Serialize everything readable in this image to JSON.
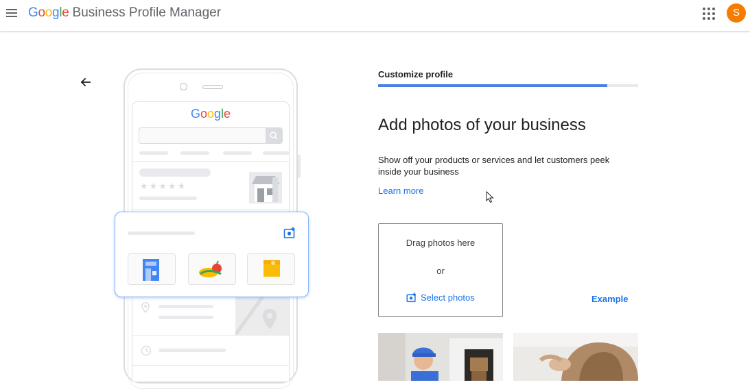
{
  "header": {
    "logo_letters": [
      "G",
      "o",
      "o",
      "g",
      "l",
      "e"
    ],
    "product": "Business Profile Manager",
    "avatar_initial": "S"
  },
  "illustration": {
    "logo_letters": [
      "G",
      "o",
      "o",
      "g",
      "l",
      "e"
    ],
    "stars": "★★★★★"
  },
  "main": {
    "step_label": "Customize profile",
    "progress": 0.88,
    "title": "Add photos of your business",
    "description": "Show off your products or services and let customers peek inside your business",
    "learn_more": "Learn more",
    "drop_text": "Drag photos here",
    "or_text": "or",
    "select_photos": "Select photos",
    "example": "Example"
  },
  "colors": {
    "accent": "#1a73e8",
    "progress": "#4a80e0",
    "avatar": "#f57c00"
  },
  "icons": [
    "menu-icon",
    "apps-icon",
    "back-arrow-icon",
    "add-photo-icon"
  ]
}
